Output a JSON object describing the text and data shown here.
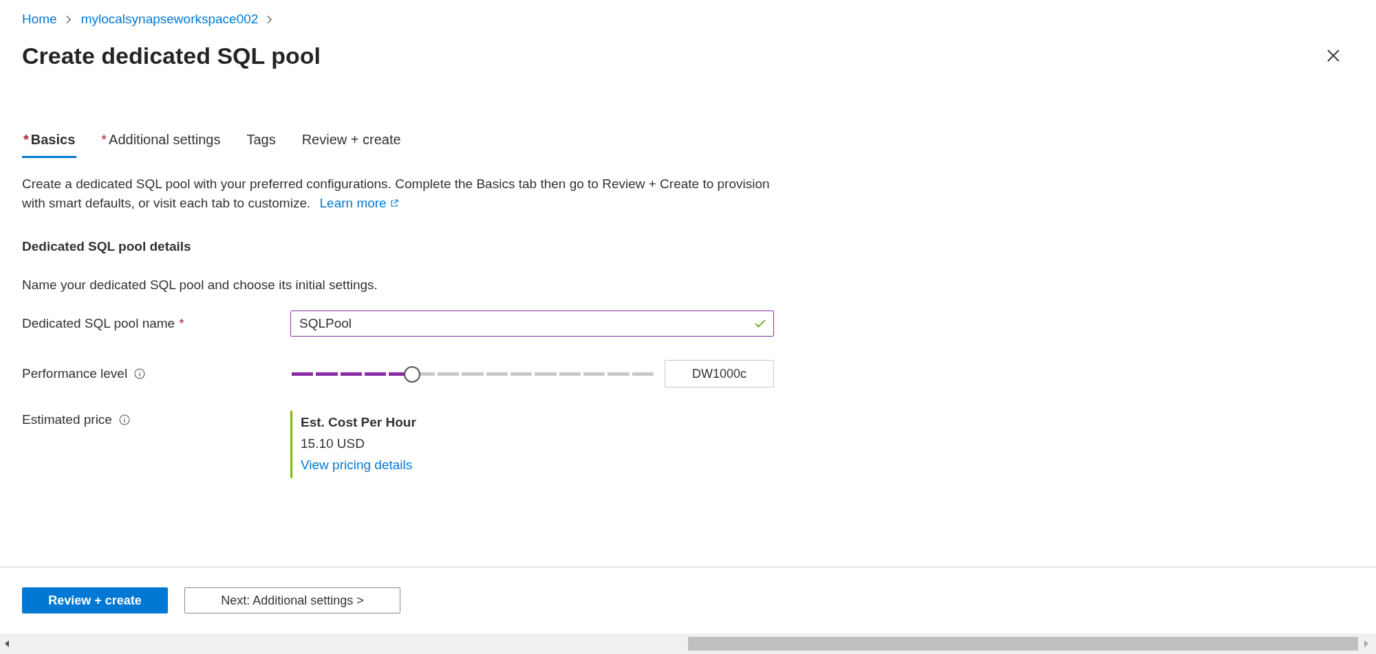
{
  "breadcrumb": [
    {
      "label": "Home"
    },
    {
      "label": "mylocalsynapseworkspace002"
    }
  ],
  "title": "Create dedicated SQL pool",
  "tabs": [
    {
      "required_mark": "*",
      "label": "Basics",
      "selected": true
    },
    {
      "required_mark": "*",
      "label": "Additional settings",
      "selected": false
    },
    {
      "label": "Tags",
      "selected": false
    },
    {
      "label": "Review + create",
      "selected": false
    }
  ],
  "description": "Create a dedicated SQL pool with your preferred configurations. Complete the Basics tab then go to Review + Create to provision with smart defaults, or visit each tab to customize.",
  "learn_more": "Learn more",
  "section": {
    "title": "Dedicated SQL pool details",
    "subtitle": "Name your dedicated SQL pool and choose its initial settings."
  },
  "name_field": {
    "label": "Dedicated SQL pool name",
    "required_mark": "*",
    "value": "SQLPool",
    "valid": true
  },
  "performance": {
    "label": "Performance level",
    "level": 0.333,
    "value": "DW1000c"
  },
  "price": {
    "label": "Estimated price",
    "heading": "Est. Cost Per Hour",
    "amount": "15.10 USD",
    "link": "View pricing details"
  },
  "buttons": {
    "primary": "Review + create",
    "secondary": "Next: Additional settings >"
  }
}
